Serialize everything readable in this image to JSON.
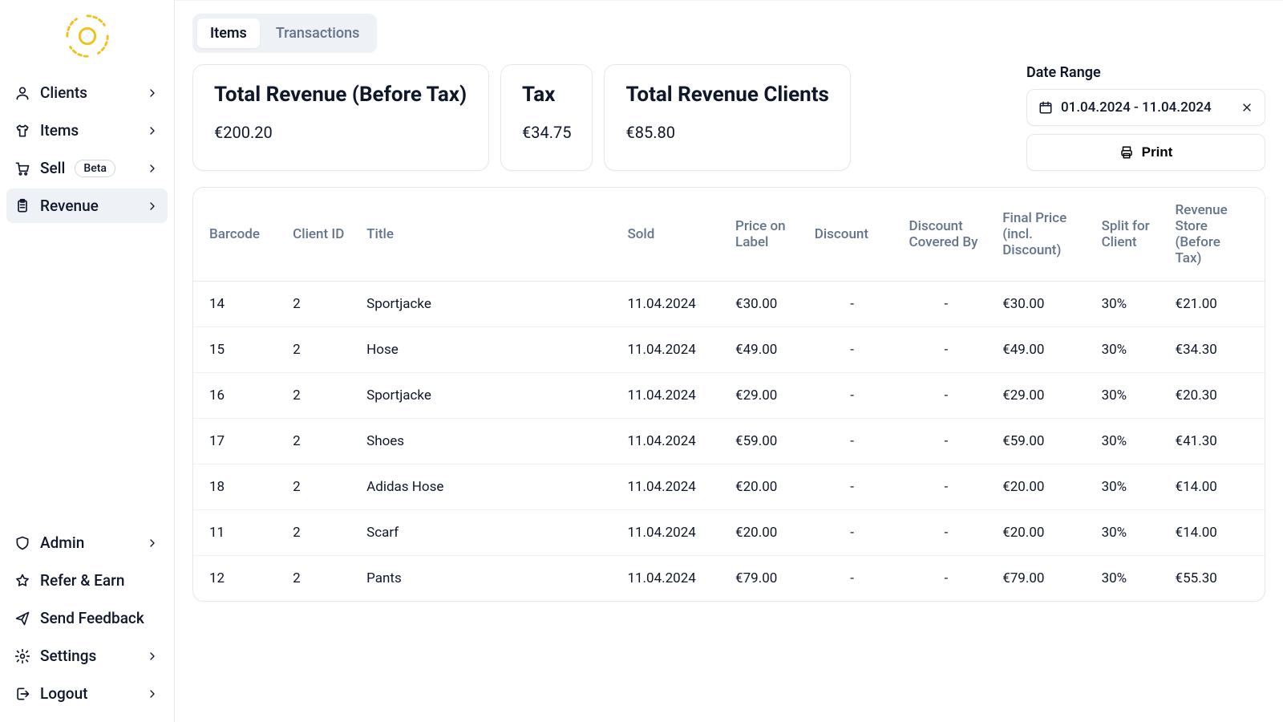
{
  "sidebar": {
    "top_items": [
      {
        "label": "Clients",
        "icon": "user-icon",
        "chevron": true
      },
      {
        "label": "Items",
        "icon": "shirt-icon",
        "chevron": true
      },
      {
        "label": "Sell",
        "icon": "cart-icon",
        "chevron": true,
        "badge": "Beta"
      },
      {
        "label": "Revenue",
        "icon": "clipboard-icon",
        "chevron": true,
        "active": true
      }
    ],
    "bottom_items": [
      {
        "label": "Admin",
        "icon": "shield-icon",
        "chevron": true
      },
      {
        "label": "Refer & Earn",
        "icon": "star-icon",
        "chevron": false
      },
      {
        "label": "Send Feedback",
        "icon": "send-icon",
        "chevron": false
      },
      {
        "label": "Settings",
        "icon": "gear-icon",
        "chevron": true
      },
      {
        "label": "Logout",
        "icon": "logout-icon",
        "chevron": true
      }
    ]
  },
  "tabs": {
    "items": "Items",
    "transactions": "Transactions",
    "active": "items"
  },
  "summary": {
    "total_rev_label": "Total Revenue (Before Tax)",
    "total_rev_value": "€200.20",
    "tax_label": "Tax",
    "tax_value": "€34.75",
    "clients_rev_label": "Total Revenue Clients",
    "clients_rev_value": "€85.80"
  },
  "controls": {
    "date_label": "Date Range",
    "date_value": "01.04.2024 - 11.04.2024",
    "print_label": "Print"
  },
  "table": {
    "columns": [
      "Barcode",
      "Client ID",
      "Title",
      "Sold",
      "Price on Label",
      "Discount",
      "Discount Covered By",
      "Final Price (incl. Discount)",
      "Split for Client",
      "Revenue Store (Before Tax)"
    ],
    "rows": [
      {
        "barcode": "14",
        "client_id": "2",
        "title": "Sportjacke",
        "sold": "11.04.2024",
        "price": "€30.00",
        "discount": "-",
        "discount_by": "-",
        "final": "€30.00",
        "split": "30%",
        "rev_store": "€21.00"
      },
      {
        "barcode": "15",
        "client_id": "2",
        "title": "Hose",
        "sold": "11.04.2024",
        "price": "€49.00",
        "discount": "-",
        "discount_by": "-",
        "final": "€49.00",
        "split": "30%",
        "rev_store": "€34.30"
      },
      {
        "barcode": "16",
        "client_id": "2",
        "title": "Sportjacke",
        "sold": "11.04.2024",
        "price": "€29.00",
        "discount": "-",
        "discount_by": "-",
        "final": "€29.00",
        "split": "30%",
        "rev_store": "€20.30"
      },
      {
        "barcode": "17",
        "client_id": "2",
        "title": "Shoes",
        "sold": "11.04.2024",
        "price": "€59.00",
        "discount": "-",
        "discount_by": "-",
        "final": "€59.00",
        "split": "30%",
        "rev_store": "€41.30"
      },
      {
        "barcode": "18",
        "client_id": "2",
        "title": "Adidas Hose",
        "sold": "11.04.2024",
        "price": "€20.00",
        "discount": "-",
        "discount_by": "-",
        "final": "€20.00",
        "split": "30%",
        "rev_store": "€14.00"
      },
      {
        "barcode": "11",
        "client_id": "2",
        "title": "Scarf",
        "sold": "11.04.2024",
        "price": "€20.00",
        "discount": "-",
        "discount_by": "-",
        "final": "€20.00",
        "split": "30%",
        "rev_store": "€14.00"
      },
      {
        "barcode": "12",
        "client_id": "2",
        "title": "Pants",
        "sold": "11.04.2024",
        "price": "€79.00",
        "discount": "-",
        "discount_by": "-",
        "final": "€79.00",
        "split": "30%",
        "rev_store": "€55.30"
      }
    ]
  }
}
